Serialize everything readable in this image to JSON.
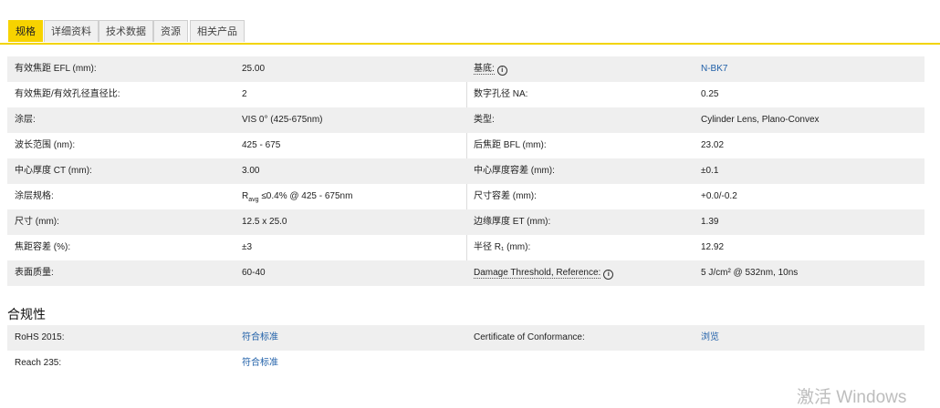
{
  "tabs": [
    "规格",
    "详细资料",
    "技术数据",
    "资源",
    "相关产品"
  ],
  "specs": [
    {
      "l1": "有效焦距 EFL (mm):",
      "v1": "25.00",
      "l2": "基底:",
      "v2": "N-BK7"
    },
    {
      "l1": "有效焦距/有效孔径直径比:",
      "v1": "2",
      "l2": "数字孔径 NA:",
      "v2": "0.25"
    },
    {
      "l1": "涂层:",
      "v1": "VIS 0° (425-675nm)",
      "l2": "类型:",
      "v2": "Cylinder Lens, Plano-Convex"
    },
    {
      "l1": "波长范围 (nm):",
      "v1": "425 - 675",
      "l2": "后焦距 BFL (mm):",
      "v2": "23.02"
    },
    {
      "l1": "中心厚度 CT (mm):",
      "v1": "3.00",
      "l2": "中心厚度容差 (mm):",
      "v2": "±0.1"
    },
    {
      "l1": "涂层规格:",
      "v1_main": "R",
      "v1_sub": "avg",
      "v1_rest": "≤0.4% @ 425 - 675nm",
      "l2": "尺寸容差 (mm):",
      "v2": "+0.0/-0.2"
    },
    {
      "l1": "尺寸 (mm):",
      "v1": "12.5 x 25.0",
      "l2": "边缘厚度 ET (mm):",
      "v2": "1.39"
    },
    {
      "l1": "焦距容差 (%):",
      "v1": "±3",
      "l2": "半径 R₁ (mm):",
      "v2": "12.92"
    },
    {
      "l1": "表面质量:",
      "v1": "60-40",
      "l2": "Damage Threshold, Reference:",
      "v2": "5 J/cm² @ 532nm, 10ns"
    }
  ],
  "compliance": {
    "title": "合规性",
    "rows": [
      {
        "l1": "RoHS 2015:",
        "v1": "符合标准",
        "l2": "Certificate of Conformance:",
        "v2": "浏览"
      },
      {
        "l1": "Reach 235:",
        "v1": "符合标准",
        "l2": "",
        "v2": ""
      }
    ]
  },
  "info_icon_glyph": "i",
  "watermark": "激活 Windows"
}
